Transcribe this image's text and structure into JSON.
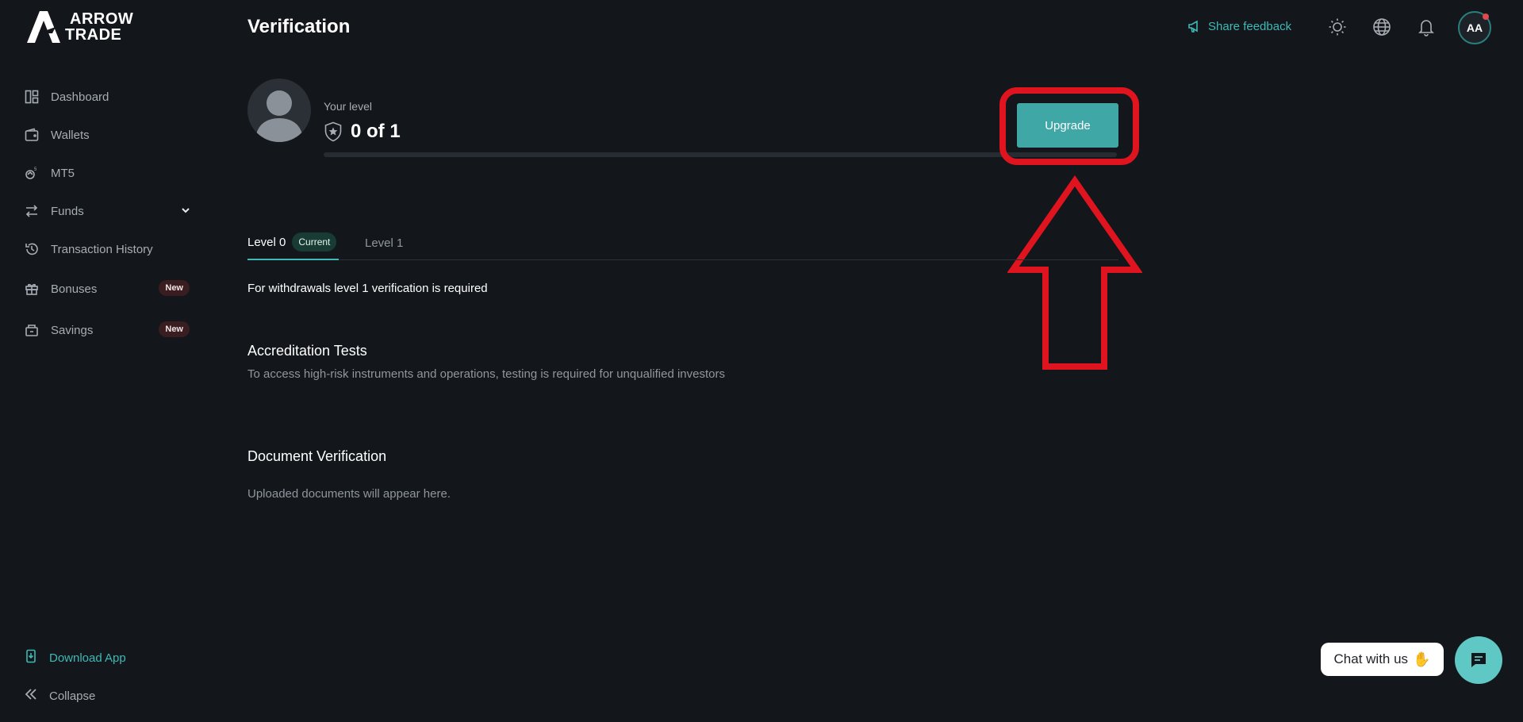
{
  "brand": {
    "line1": "ARROW",
    "line2": "TRADE"
  },
  "sidebar": {
    "items": [
      {
        "label": "Dashboard",
        "icon": "dashboard-icon"
      },
      {
        "label": "Wallets",
        "icon": "wallet-icon"
      },
      {
        "label": "MT5",
        "icon": "mt5-icon"
      },
      {
        "label": "Funds",
        "icon": "funds-icon",
        "expandable": true
      },
      {
        "label": "Transaction History",
        "icon": "history-icon"
      },
      {
        "label": "Bonuses",
        "icon": "gift-icon",
        "badge": "New"
      },
      {
        "label": "Savings",
        "icon": "savings-icon",
        "badge": "New"
      }
    ],
    "download_app": "Download App",
    "collapse": "Collapse"
  },
  "header": {
    "title": "Verification",
    "share_feedback": "Share feedback",
    "avatar_initials": "AA"
  },
  "level_card": {
    "label": "Your level",
    "value": "0 of 1",
    "progress": 0,
    "upgrade_label": "Upgrade"
  },
  "tabs": [
    {
      "label": "Level 0",
      "pill": "Current",
      "active": true
    },
    {
      "label": "Level 1",
      "active": false
    }
  ],
  "notice": "For withdrawals level 1 verification is required",
  "accreditation": {
    "title": "Accreditation Tests",
    "description": "To access high-risk instruments and operations, testing is required for unqualified investors"
  },
  "documents": {
    "title": "Document Verification",
    "description": "Uploaded documents will appear here."
  },
  "chat": {
    "label": "Chat with us"
  },
  "colors": {
    "accent": "#3fb8b6",
    "button": "#3fa8a7",
    "annotation": "#e0141e",
    "background": "#13171b"
  }
}
